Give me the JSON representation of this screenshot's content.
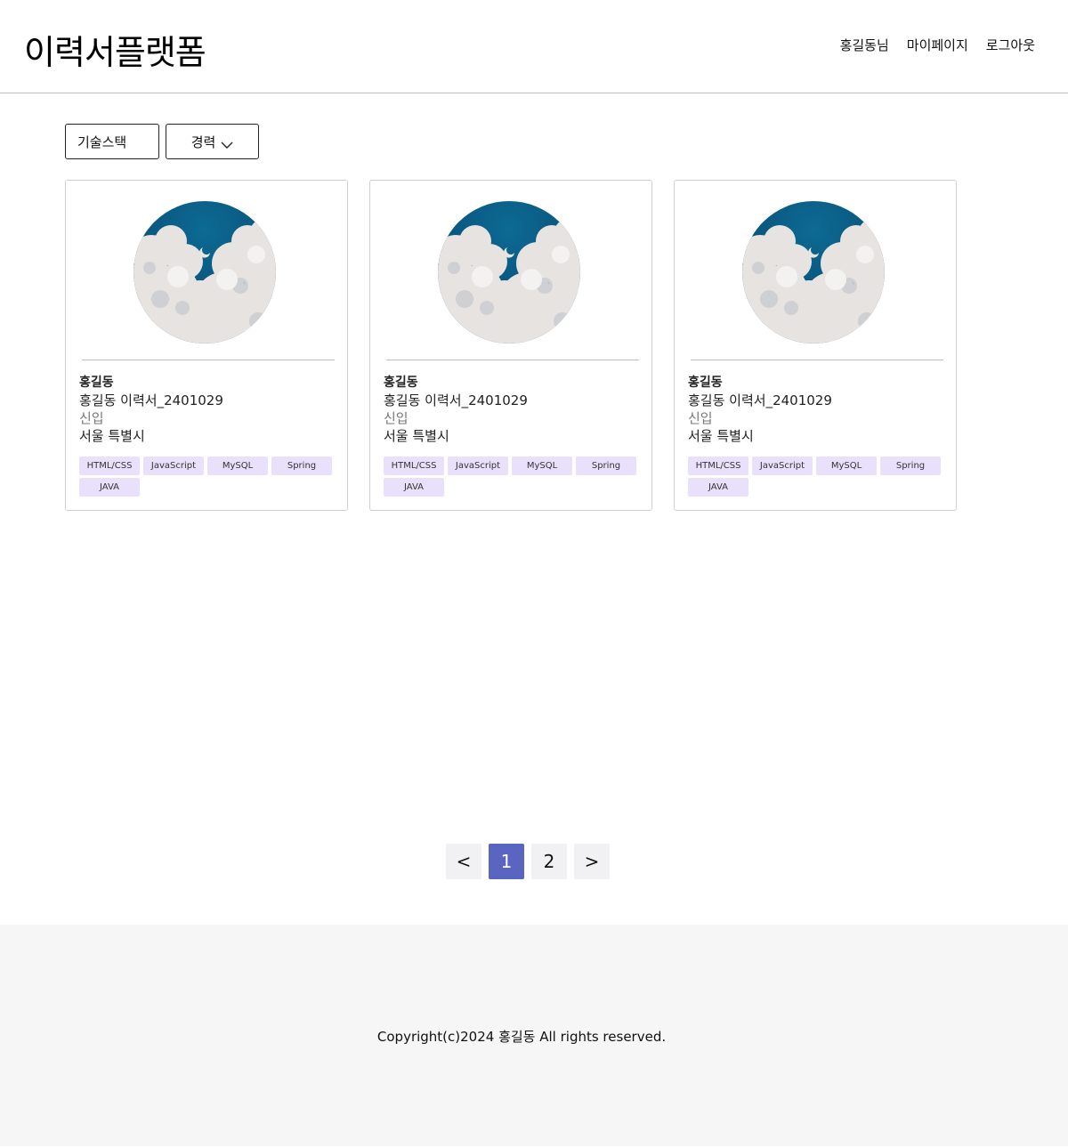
{
  "header": {
    "logo": "이력서플랫폼",
    "nav": [
      {
        "label": "홍길동님"
      },
      {
        "label": "마이페이지"
      },
      {
        "label": "로그아웃"
      }
    ]
  },
  "filters": {
    "skill_label": "기술스택",
    "career_label": "경력",
    "career_icon": "chevron-down-icon"
  },
  "cards": [
    {
      "name": "홍길동",
      "title": "홍길동 이력서_2401029",
      "career": "신입",
      "location": "서울 특별시",
      "tags": [
        "HTML/CSS",
        "JavaScript",
        "MySQL",
        "Spring",
        "JAVA"
      ]
    },
    {
      "name": "홍길동",
      "title": "홍길동 이력서_2401029",
      "career": "신입",
      "location": "서울 특별시",
      "tags": [
        "HTML/CSS",
        "JavaScript",
        "MySQL",
        "Spring",
        "JAVA"
      ]
    },
    {
      "name": "홍길동",
      "title": "홍길동 이력서_2401029",
      "career": "신입",
      "location": "서울 특별시",
      "tags": [
        "HTML/CSS",
        "JavaScript",
        "MySQL",
        "Spring",
        "JAVA"
      ]
    }
  ],
  "pagination": {
    "prev": "<",
    "pages": [
      "1",
      "2"
    ],
    "current": "1",
    "next": ">"
  },
  "footer": {
    "copyright": "Copyright(c)2024 홍길동 All rights reserved."
  },
  "colors": {
    "accent": "#5965c0",
    "tag_bg": "#e9e0fb",
    "footer_bg": "#f6f6f6",
    "sky": "#0b5a82"
  }
}
